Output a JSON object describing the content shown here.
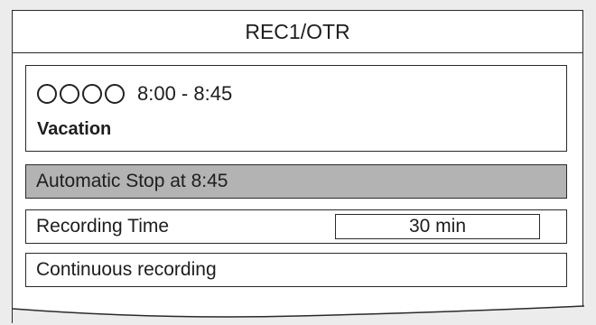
{
  "title": "REC1/OTR",
  "program": {
    "channel_icons": [
      "circle-icon",
      "circle-icon",
      "circle-icon",
      "circle-icon"
    ],
    "time_range": "8:00 - 8:45",
    "name": "Vacation"
  },
  "menu": {
    "auto_stop_label": "Automatic Stop at 8:45",
    "recording_time_label": "Recording Time",
    "recording_time_value": "30 min",
    "continuous_label": "Continuous recording"
  },
  "colors": {
    "selected_row": "#b3b3b3",
    "border": "#2a2a2a",
    "background": "#ececec"
  }
}
